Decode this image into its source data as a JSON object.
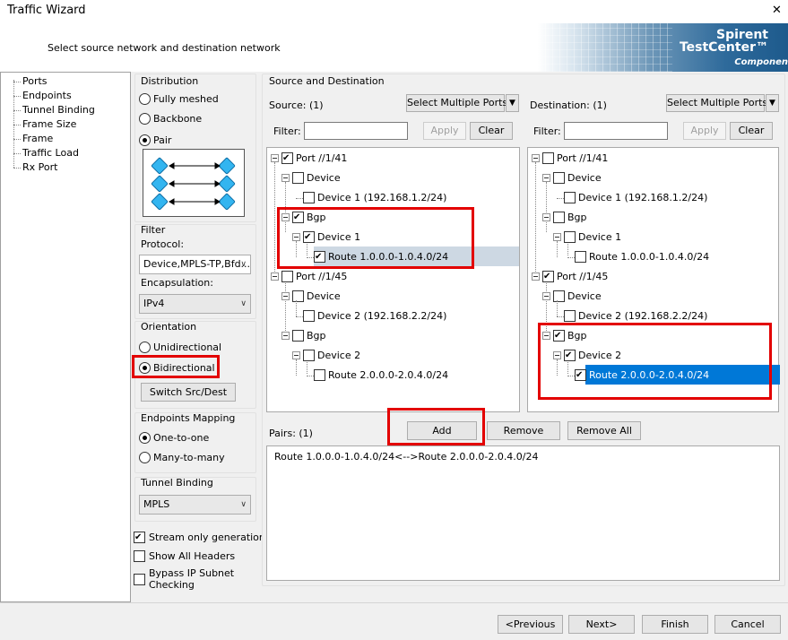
{
  "window": {
    "title": "Traffic Wizard",
    "close": "✕",
    "subtitle": "Select source network and destination network"
  },
  "logo": {
    "line1": "Spirent",
    "line2": "TestCenter™",
    "line3": "Componen"
  },
  "nav": {
    "items": [
      "Ports",
      "Endpoints",
      "Tunnel Binding",
      "Frame Size",
      "Frame",
      "Traffic Load",
      "Rx Port"
    ],
    "selected": "Endpoints"
  },
  "distribution": {
    "title": "Distribution",
    "options": [
      "Fully meshed",
      "Backbone",
      "Pair"
    ],
    "selected": "Pair"
  },
  "filter": {
    "title": "Filter",
    "protocol_label": "Protocol:",
    "protocol_value": "Device,MPLS-TP,Bfd...",
    "encapsulation_label": "Encapsulation:",
    "encapsulation_value": "IPv4"
  },
  "orientation": {
    "title": "Orientation",
    "options": [
      "Unidirectional",
      "Bidirectional"
    ],
    "selected": "Bidirectional",
    "switch_button": "Switch Src/Dest"
  },
  "endpoints_mapping": {
    "title": "Endpoints Mapping",
    "options": [
      "One-to-one",
      "Many-to-many"
    ],
    "selected": "One-to-one"
  },
  "tunnel_binding": {
    "title": "Tunnel Binding",
    "value": "MPLS"
  },
  "checkboxes": {
    "stream_only": {
      "label": "Stream only generation",
      "checked": true
    },
    "show_all_headers": {
      "label": "Show All Headers",
      "checked": false
    },
    "bypass_ip_line1": "Bypass IP Subnet",
    "bypass_ip_line2": "Checking"
  },
  "source_dest": {
    "title": "Source and Destination",
    "source_label": "Source: (1)",
    "destination_label": "Destination: (1)",
    "select_multiple_ports": "Select Multiple Ports",
    "dropdown_arrow": "▼",
    "filter_label": "Filter:",
    "apply": "Apply",
    "clear": "Clear",
    "source_tree": [
      "Port //1/41",
      "Device",
      "Device 1 (192.168.1.2/24)",
      "Bgp",
      "Device 1",
      "Route 1.0.0.0-1.0.4.0/24",
      "Port //1/45",
      "Device",
      "Device 2 (192.168.2.2/24)",
      "Bgp",
      "Device 2",
      "Route 2.0.0.0-2.0.4.0/24"
    ],
    "destination_tree": [
      "Port //1/41",
      "Device",
      "Device 1 (192.168.1.2/24)",
      "Bgp",
      "Device 1",
      "Route 1.0.0.0-1.0.4.0/24",
      "Port //1/45",
      "Device",
      "Device 2 (192.168.2.2/24)",
      "Bgp",
      "Device 2",
      "Route 2.0.0.0-2.0.4.0/24"
    ]
  },
  "pair_actions": {
    "add": "Add",
    "remove": "Remove",
    "remove_all": "Remove All"
  },
  "pairs": {
    "label": "Pairs: (1)",
    "items": [
      "Route 1.0.0.0-1.0.4.0/24<-->Route 2.0.0.0-2.0.4.0/24"
    ]
  },
  "footer": {
    "previous": "<Previous",
    "next": "Next>",
    "finish": "Finish",
    "cancel": "Cancel"
  },
  "colors": {
    "highlight_red": "#e30000",
    "selection_blue": "#0078d7",
    "selection_gray": "#cdd8e3"
  }
}
